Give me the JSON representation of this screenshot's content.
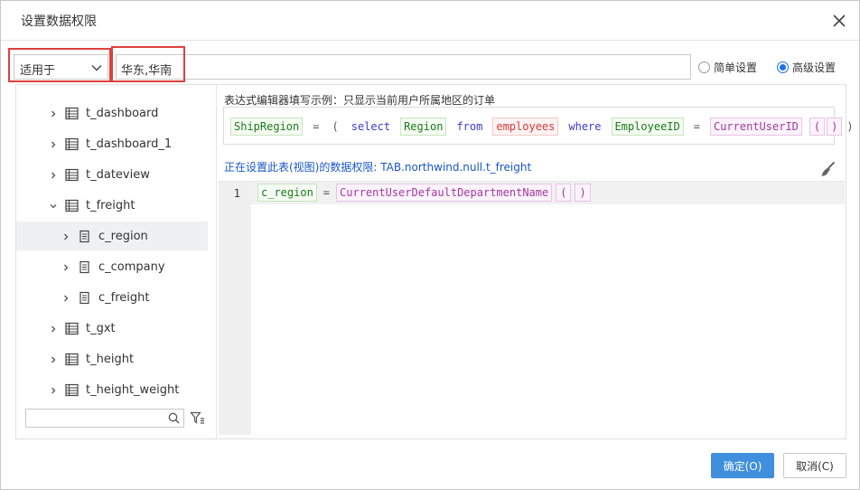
{
  "dialog": {
    "title": "设置数据权限",
    "close_icon": "close-icon"
  },
  "toolbar": {
    "scope_select_value": "适用于",
    "scope_input_value": "华东,华南",
    "radio_simple_label": "简单设置",
    "radio_advanced_label": "高级设置",
    "selected_mode": "advanced"
  },
  "tree": {
    "items": [
      {
        "label": "t_dashboard",
        "level": 0,
        "expanded": false,
        "selected": false
      },
      {
        "label": "t_dashboard_1",
        "level": 0,
        "expanded": false,
        "selected": false
      },
      {
        "label": "t_dateview",
        "level": 0,
        "expanded": false,
        "selected": false
      },
      {
        "label": "t_freight",
        "level": 0,
        "expanded": true,
        "selected": false
      },
      {
        "label": "c_region",
        "level": 1,
        "expanded": false,
        "selected": true
      },
      {
        "label": "c_company",
        "level": 1,
        "expanded": false,
        "selected": false
      },
      {
        "label": "c_freight",
        "level": 1,
        "expanded": false,
        "selected": false
      },
      {
        "label": "t_gxt",
        "level": 0,
        "expanded": false,
        "selected": false
      },
      {
        "label": "t_height",
        "level": 0,
        "expanded": false,
        "selected": false
      },
      {
        "label": "t_height_weight",
        "level": 0,
        "expanded": false,
        "selected": false
      }
    ],
    "search_placeholder": ""
  },
  "editor": {
    "example_caption": "表达式编辑器填写示例：只显示当前用户所属地区的订单",
    "example_tokens": [
      {
        "text": "ShipRegion",
        "kind": "field"
      },
      {
        "text": "=",
        "kind": "op"
      },
      {
        "text": "(",
        "kind": "op"
      },
      {
        "text": "select",
        "kind": "kw"
      },
      {
        "text": "Region",
        "kind": "field"
      },
      {
        "text": "from",
        "kind": "kw"
      },
      {
        "text": "employees",
        "kind": "table"
      },
      {
        "text": "where",
        "kind": "kw"
      },
      {
        "text": "EmployeeID",
        "kind": "field"
      },
      {
        "text": "=",
        "kind": "op"
      },
      {
        "text": "CurrentUserID",
        "kind": "func"
      },
      {
        "text": "(",
        "kind": "paren"
      },
      {
        "text": ")",
        "kind": "paren"
      },
      {
        "text": ")",
        "kind": "op"
      }
    ],
    "status_text": "正在设置此表(视图)的数据权限: TAB.northwind.null.t_freight",
    "line_number": "1",
    "code_tokens": [
      {
        "text": "c_region",
        "kind": "field"
      },
      {
        "text": "=",
        "kind": "op"
      },
      {
        "text": "CurrentUserDefaultDepartmentName",
        "kind": "func"
      },
      {
        "text": "(",
        "kind": "paren"
      },
      {
        "text": ")",
        "kind": "paren"
      }
    ]
  },
  "footer": {
    "ok_label": "确定(O)",
    "cancel_label": "取消(C)"
  },
  "colors": {
    "primary": "#3f8fde",
    "highlight_border": "#e0403d",
    "status_blue": "#1a56c8"
  }
}
